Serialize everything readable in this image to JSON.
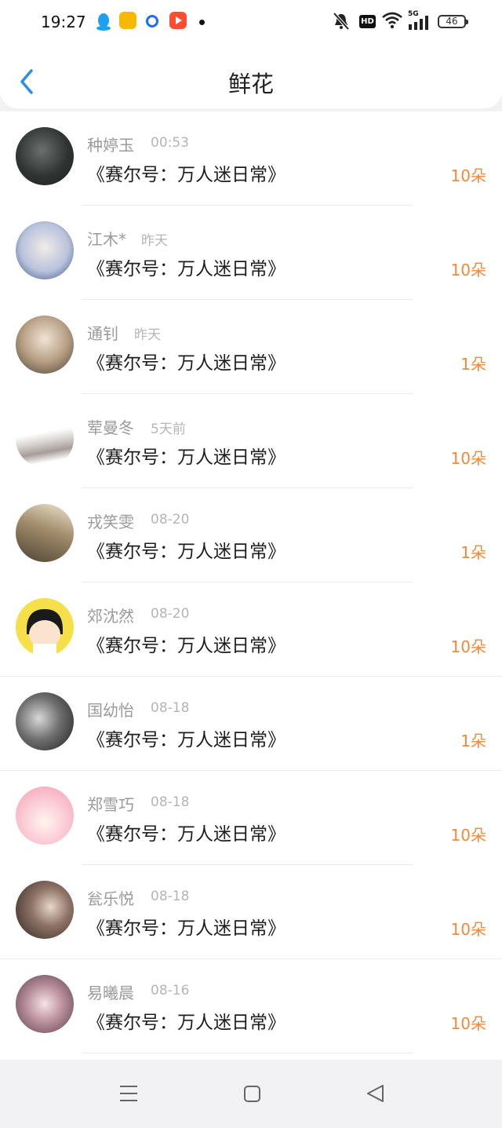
{
  "status_bar": {
    "time": "19:27",
    "hd_label": "HD",
    "signal_label": "5G",
    "battery": "46"
  },
  "header": {
    "title": "鲜花",
    "back_icon": "chevron-left-icon",
    "accent": "#2b8fe6"
  },
  "rows": [
    {
      "name": "种婷玉",
      "time": "00:53",
      "book": "《赛尔号：万人迷日常》",
      "count": "10朵"
    },
    {
      "name": "江木*",
      "time": "昨天",
      "book": "《赛尔号：万人迷日常》",
      "count": "10朵"
    },
    {
      "name": "通钊",
      "time": "昨天",
      "book": "《赛尔号：万人迷日常》",
      "count": "1朵"
    },
    {
      "name": "荤曼冬",
      "time": "5天前",
      "book": "《赛尔号：万人迷日常》",
      "count": "10朵"
    },
    {
      "name": "戎笑雯",
      "time": "08-20",
      "book": "《赛尔号：万人迷日常》",
      "count": "1朵"
    },
    {
      "name": "郊沈然",
      "time": "08-20",
      "book": "《赛尔号：万人迷日常》",
      "count": "10朵"
    },
    {
      "name": "国幼怡",
      "time": "08-18",
      "book": "《赛尔号：万人迷日常》",
      "count": "1朵"
    },
    {
      "name": "郑雪巧",
      "time": "08-18",
      "book": "《赛尔号：万人迷日常》",
      "count": "10朵"
    },
    {
      "name": "瓮乐悦",
      "time": "08-18",
      "book": "《赛尔号：万人迷日常》",
      "count": "10朵"
    },
    {
      "name": "易曦晨",
      "time": "08-16",
      "book": "《赛尔号：万人迷日常》",
      "count": "10朵"
    }
  ],
  "colors": {
    "count": "#f08a3a",
    "name": "#9a9a9a",
    "time": "#b5b5b5"
  },
  "nav": {
    "menu_icon": "menu-icon",
    "home_icon": "square-home-icon",
    "back_icon": "triangle-back-icon"
  }
}
